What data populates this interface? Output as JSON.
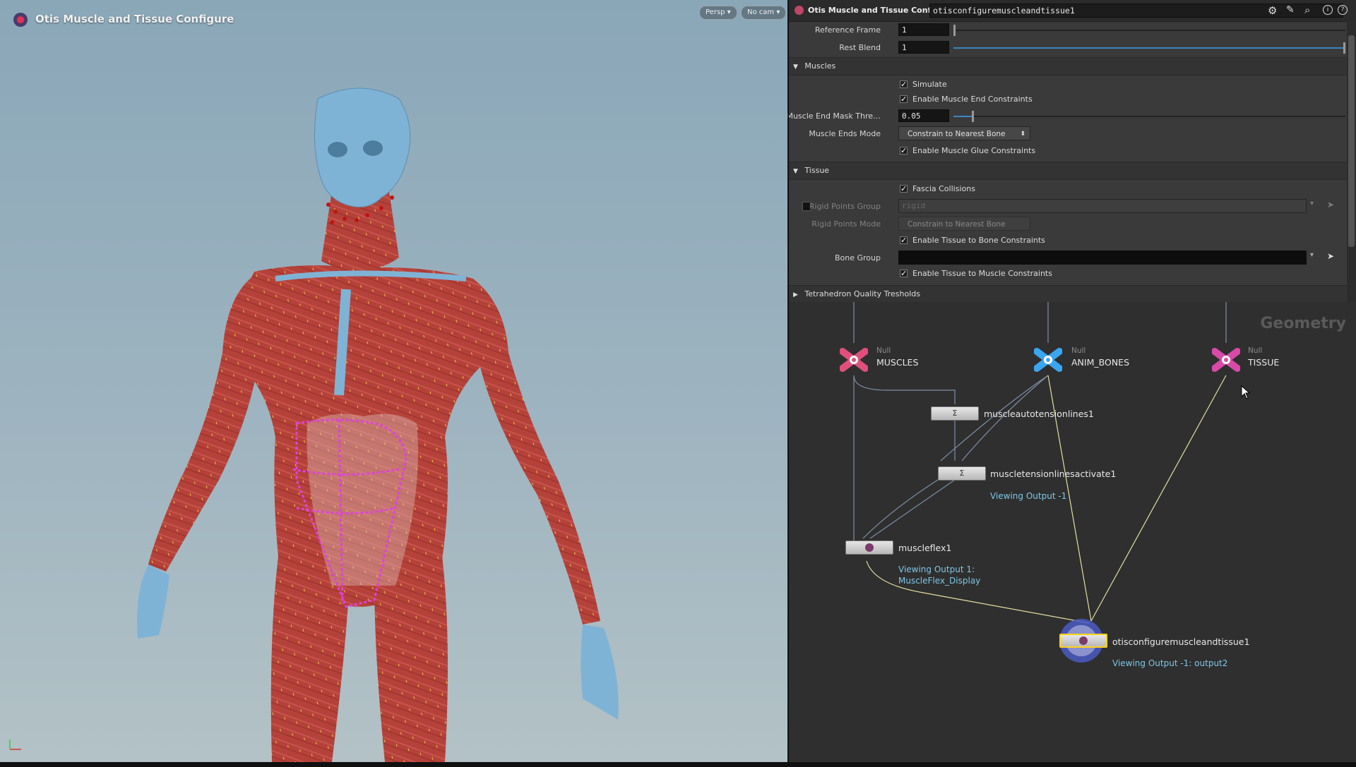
{
  "viewport": {
    "title": "Otis Muscle and Tissue Configure",
    "persp_label": "Persp ▾",
    "cam_label": "No cam ▾",
    "axes_label": "z  x"
  },
  "params": {
    "header_title": "Otis Muscle and Tissue Configure",
    "node_name": "otisconfiguremuscleandtissue1",
    "reference_frame_label": "Reference Frame",
    "reference_frame_value": "1",
    "rest_blend_label": "Rest Blend",
    "rest_blend_value": "1",
    "muscles_section": "Muscles",
    "simulate_label": "Simulate",
    "enable_muscle_end_label": "Enable Muscle End Constraints",
    "muscle_end_mask_label": "Muscle End Mask Thre…",
    "muscle_end_mask_value": "0.05",
    "muscle_ends_mode_label": "Muscle Ends Mode",
    "muscle_ends_mode_value": "Constrain to Nearest Bone",
    "enable_glue_label": "Enable Muscle Glue Constraints",
    "tissue_section": "Tissue",
    "fascia_label": "Fascia Collisions",
    "rigid_group_label": "Rigid Points Group",
    "rigid_group_value": "rigid",
    "rigid_mode_label": "Rigid Points Mode",
    "rigid_mode_value": "Constrain to Nearest Bone",
    "enable_tissue_bone_label": "Enable Tissue to Bone Constraints",
    "bone_group_label": "Bone Group",
    "bone_group_value": "",
    "enable_tissue_muscle_label": "Enable Tissue to Muscle Constraints",
    "tetra_section": "Tetrahedron Quality Tresholds"
  },
  "network": {
    "context_label": "Geometry",
    "null_type": "Null",
    "muscles_node": "MUSCLES",
    "anim_bones_node": "ANIM_BONES",
    "tissue_node": "TISSUE",
    "autotension_node": "muscleautotensionlines1",
    "tensionactivate_node": "muscletensionlinesactivate1",
    "tensionactivate_view": "Viewing Output -1",
    "muscleflex_node": "muscleflex1",
    "muscleflex_view_1": "Viewing Output 1:",
    "muscleflex_view_2": "MuscleFlex_Display",
    "configure_node": "otisconfiguremuscleandtissue1",
    "configure_view": "Viewing Output -1: output2"
  },
  "colors": {
    "muscle": "#b5423a",
    "bone": "#7fb3d5",
    "magenta": "#e040e0",
    "null_pink": "#e0507a",
    "null_blue": "#3aa6f0",
    "link_cyan": "#7ec7e6"
  }
}
